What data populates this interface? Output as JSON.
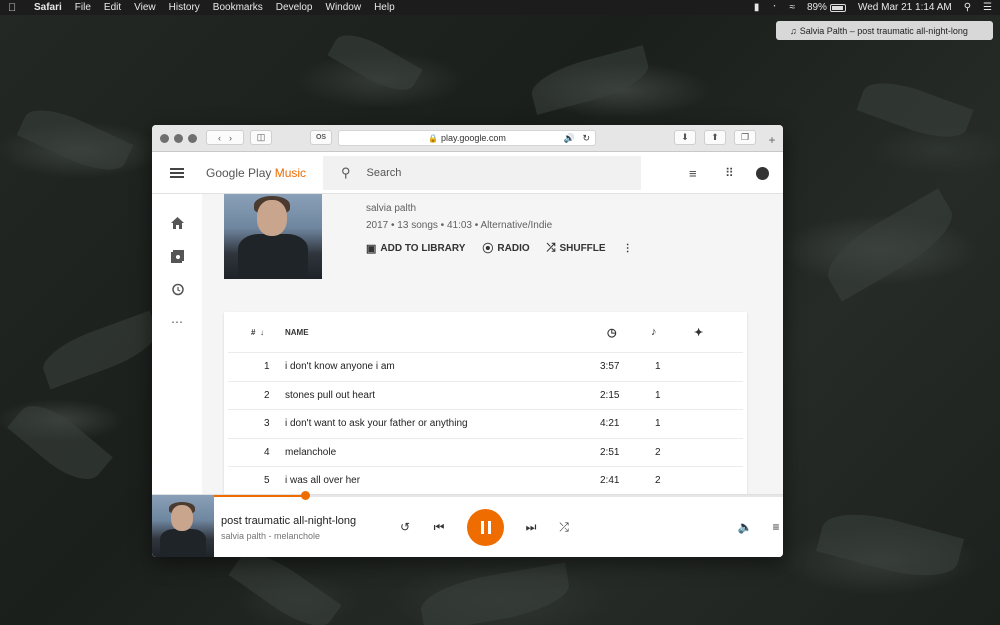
{
  "menubar": {
    "app_name": "Safari",
    "items": [
      "File",
      "Edit",
      "View",
      "History",
      "Bookmarks",
      "Develop",
      "Window",
      "Help"
    ],
    "battery": "89%",
    "datetime": "Wed Mar 21  1:14 AM"
  },
  "toast": {
    "text": "Salvia Palth – post traumatic all-night-long"
  },
  "browser": {
    "url": "play.google.com"
  },
  "app": {
    "logo_google": "Google Play",
    "logo_music": "Music",
    "search_placeholder": "Search"
  },
  "album": {
    "artist": "salvia palth",
    "meta": "2017 • 13 songs • 41:03 • Alternative/Indie",
    "actions": {
      "add_to_library": "ADD TO LIBRARY",
      "radio": "RADIO",
      "shuffle": "SHUFFLE"
    }
  },
  "tracklist": {
    "header": {
      "number": "#",
      "name": "NAME"
    },
    "rows": [
      {
        "num": "1",
        "title": "i don't know anyone i am",
        "duration": "3:57",
        "plays": "1"
      },
      {
        "num": "2",
        "title": "stones pull out heart",
        "duration": "2:15",
        "plays": "1"
      },
      {
        "num": "3",
        "title": "i don't want to ask your father or anything",
        "duration": "4:21",
        "plays": "1"
      },
      {
        "num": "4",
        "title": "melanchole",
        "duration": "2:51",
        "plays": "2"
      },
      {
        "num": "5",
        "title": "i was all over her",
        "duration": "2:41",
        "plays": "2"
      }
    ]
  },
  "player": {
    "title": "post traumatic all-night-long",
    "subtitle": "salvia palth - melanchole",
    "progress_fraction": 0.16
  },
  "colors": {
    "accent": "#ef6c00"
  }
}
